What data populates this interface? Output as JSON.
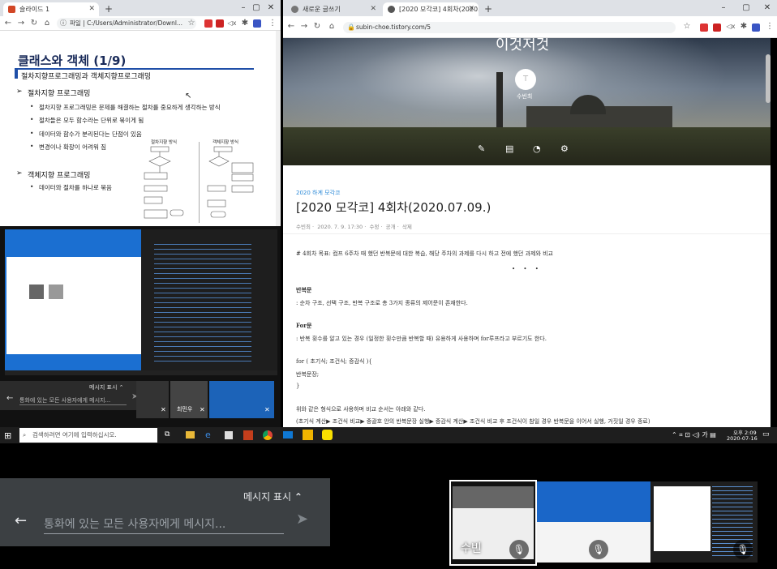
{
  "left_browser": {
    "tab_title": "슬라이드 1",
    "address": "파일 | C:/Users/Administrator/Downl...",
    "slide": {
      "title": "클래스와 객체 (1/9)",
      "subtitle": "절차지향프로그래밍과 객체지향프로그래밍",
      "section1": "절차지향 프로그래밍",
      "items1": [
        "절차지향 프로그래밍은 문제를 해결하는 절차를 중요하게 생각하는 방식",
        "절차들은 모두 함수라는 단위로 묶이게 됨",
        "데이터와 함수가 분리된다는 단점이 있음",
        "변경이나 확장이 어려워 짐"
      ],
      "section2": "객체지향 프로그래밍",
      "items2": [
        "데이터와 절차를 하나로 묶음"
      ],
      "diagram_left": "절차지향 방식",
      "diagram_right": "객체지향 방식"
    }
  },
  "right_browser": {
    "tabs": [
      "새로운 글쓰기",
      "[2020 모각코] 4회차(2020.07.0..."
    ],
    "address": "subin-choe.tistory.com/5",
    "blog": {
      "hero_title": "이것저것",
      "author": "수빈최",
      "category": "2020 하계 모각코",
      "title": "[2020 모각코] 4회차(2020.07.09.)",
      "meta": [
        "수빈최",
        "2020. 7. 9. 17:30",
        "수정",
        "공개",
        "삭제"
      ],
      "body": [
        "# 4회차 목표: 컴프 6주차 때 했던 반복문에 대한 복습, 해당 주차의 과제를 다시 하고 전에 했던 과제와 비교",
        "• • •",
        "반복문",
        ": 순차 구조, 선택 구조, 반복 구조로 총 3가지 종류의 제어문이 존재한다.",
        "For문",
        ": 반복 횟수를 알고 있는 경우 (일정한 횟수만큼 반복할 때) 유용하게 사용하며 for루프라고 부르기도 한다.",
        "for ( 초기식; 조건식; 증감식 ){",
        "반복문장;",
        "}",
        "위와 같은 형식으로 사용하며 비교 순서는 아래와 같다.",
        "(초기식 계산▶ 조건식 비교▶ 중괄호 안의 반복문장 실행▶ 증감식 계산▶ 조건식 비교 후 조건식이 참일 경우 반복문을 이어서 실행, 거짓일 경우 종료)"
      ]
    }
  },
  "mini_meet": {
    "show_messages": "메시지 표시",
    "placeholder": "통화에 있는 모든 사용자에게 메시지...",
    "tile_name": "최민우"
  },
  "taskbar": {
    "search_placeholder": "검색하려면 여기에 입력하십시오.",
    "time": "오후 2:09",
    "date": "2020-07-16"
  },
  "meet": {
    "show_messages": "메시지 표시",
    "placeholder": "통화에 있는 모든 사용자에게 메시지...",
    "self_name": "수빈"
  },
  "colors": {
    "accent": "#1a73e8",
    "blog_accent": "#2e8bd8"
  }
}
